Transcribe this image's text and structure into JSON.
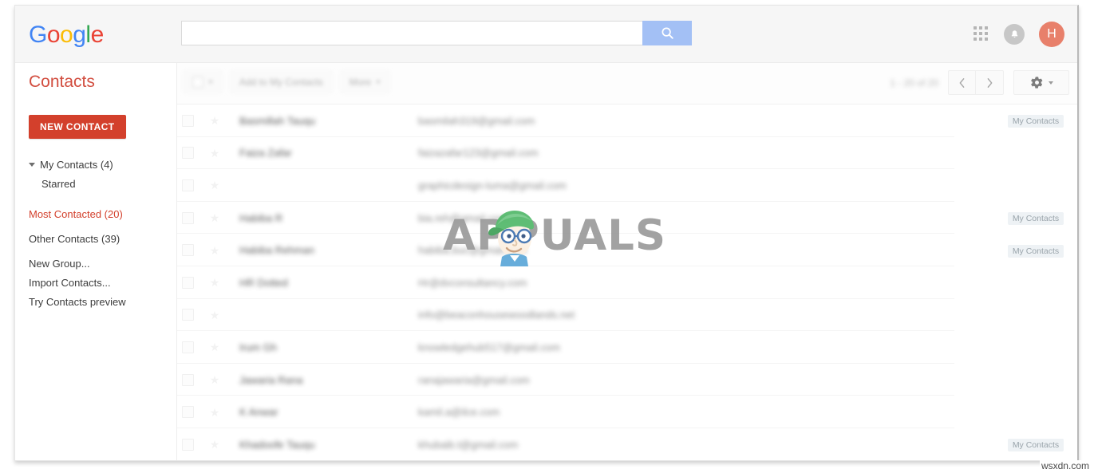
{
  "header": {
    "logo_text": "Google",
    "logo_letters": [
      "G",
      "o",
      "o",
      "g",
      "l",
      "e"
    ],
    "search": {
      "value": "",
      "placeholder": "",
      "button_icon": "search-icon"
    },
    "apps_icon": "apps-grid-icon",
    "notifications_icon": "bell-icon",
    "avatar_initial": "H",
    "avatar_color": "#e8806b"
  },
  "sidebar": {
    "title": "Contacts",
    "title_color": "#d24d3f",
    "new_contact_label": "NEW CONTACT",
    "new_contact_color": "#d3402c",
    "items": [
      {
        "label": "My Contacts (4)",
        "active": false,
        "caret": true,
        "indent": false
      },
      {
        "label": "Starred",
        "active": false,
        "caret": false,
        "indent": true
      },
      {
        "label": "Most Contacted (20)",
        "active": true,
        "caret": false,
        "indent": false
      },
      {
        "label": "Other Contacts (39)",
        "active": false,
        "caret": false,
        "indent": false
      },
      {
        "label": "New Group...",
        "active": false,
        "caret": false,
        "indent": false
      },
      {
        "label": "Import Contacts...",
        "active": false,
        "caret": false,
        "indent": false
      },
      {
        "label": "Try Contacts preview",
        "active": false,
        "caret": false,
        "indent": false
      }
    ]
  },
  "toolbar": {
    "select_all_label": "",
    "add_to_my_contacts_label": "Add to My Contacts",
    "more_label": "More",
    "count_label": "1 - 20 of 20",
    "prev_icon": "chevron-left-icon",
    "next_icon": "chevron-right-icon",
    "settings_icon": "gear-icon",
    "settings_caret_icon": "chevron-down-icon"
  },
  "contacts": {
    "group_chip_label": "My Contacts",
    "rows": [
      {
        "name": "Basmillah Tauqu",
        "email": "basmilah319@gmail.com",
        "group": "My Contacts"
      },
      {
        "name": "Faiza Zafar",
        "email": "faizazafar123@gmail.com",
        "group": ""
      },
      {
        "name": "",
        "email": "graphicdesign-luma@gmail.com",
        "group": ""
      },
      {
        "name": "Habiba R",
        "email": "bia.reh@gmail.com",
        "group": "My Contacts"
      },
      {
        "name": "Habiba Rehman",
        "email": "habiba.buc@gmail.com",
        "group": "My Contacts"
      },
      {
        "name": "HR Dotted",
        "email": "Hr@dvconsultancy.com",
        "group": ""
      },
      {
        "name": "",
        "email": "info@beaconhousewoodlands.net",
        "group": ""
      },
      {
        "name": "Irum Gh",
        "email": "knowledgehub517@gmail.com",
        "group": ""
      },
      {
        "name": "Jawaria Rana",
        "email": "ranajawaria@gmail.com",
        "group": ""
      },
      {
        "name": "K Anwar",
        "email": "kamil.a@ilce.com",
        "group": ""
      },
      {
        "name": "Khadoofe Tauqu",
        "email": "khubaib.t@gmail.com",
        "group": "My Contacts"
      }
    ]
  },
  "watermark": {
    "text": "APPUALS",
    "mascot_icon": "appuals-mascot-icon"
  },
  "source_tag": "wsxdn.com"
}
